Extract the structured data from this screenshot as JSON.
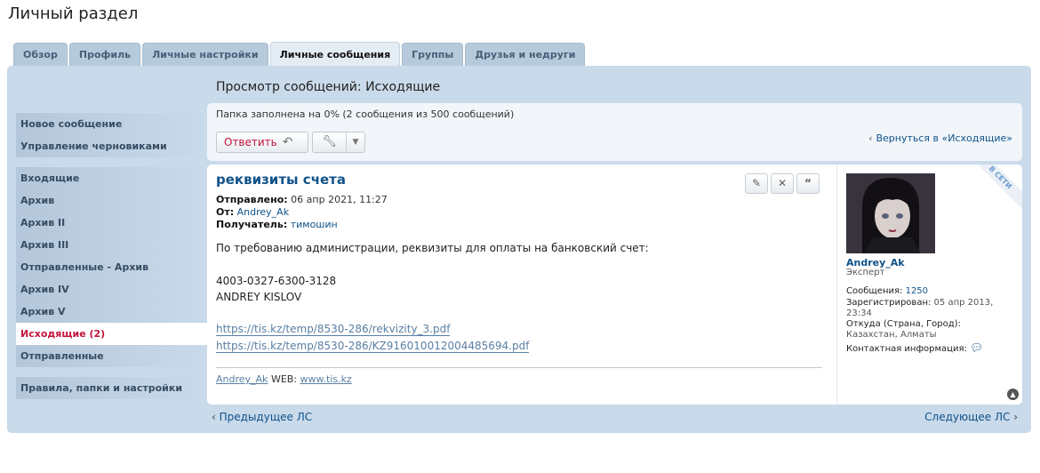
{
  "page": {
    "title": "Личный раздел"
  },
  "tabs": [
    {
      "label": "Обзор",
      "active": false
    },
    {
      "label": "Профиль",
      "active": false
    },
    {
      "label": "Личные настройки",
      "active": false
    },
    {
      "label": "Личные сообщения",
      "active": true
    },
    {
      "label": "Группы",
      "active": false
    },
    {
      "label": "Друзья и недруги",
      "active": false
    }
  ],
  "sidebar": {
    "group1": [
      "Новое сообщение",
      "Управление черновиками"
    ],
    "group2": [
      "Входящие",
      "Архив",
      "Архив II",
      "Архив III",
      "Отправленные - Архив",
      "Архив IV",
      "Архив V",
      "Исходящие (2)",
      "Отправленные"
    ],
    "group3": [
      "Правила, папки и настройки"
    ],
    "active_item": "Исходящие (2)"
  },
  "view": {
    "title": "Просмотр сообщений: Исходящие",
    "folder_status": "Папка заполнена на 0% (2 сообщения из 500 сообщений)",
    "reply_label": "Ответить",
    "back_link": "Вернуться в «Исходящие»"
  },
  "message": {
    "subject": "реквизиты счета",
    "sent_label": "Отправлено:",
    "sent_value": "06 апр 2021, 11:27",
    "from_label": "От:",
    "from_value": "Andrey_Ak",
    "to_label": "Получатель:",
    "to_value": "тимошин",
    "body_line1": "По требованию администрации, реквизиты для оплаты на банковский счет:",
    "account": "4003-0327-6300-3128",
    "holder": "ANDREY KISLOV",
    "attachments": [
      "https://tis.kz/temp/8530-286/rekvizity_3.pdf",
      "https://tis.kz/temp/8530-286/KZ916010012004485694.pdf"
    ],
    "signature": {
      "name": "Andrey_Ak",
      "web_label": "WEB:",
      "web_url": "www.tis.kz"
    }
  },
  "profile": {
    "username": "Andrey_Ak",
    "rank": "Эксперт",
    "online_label": "В СЕТИ",
    "posts_label": "Сообщения:",
    "posts_value": "1250",
    "registered_label": "Зарегистрирован:",
    "registered_value": "05 апр 2013, 23:34",
    "location_label": "Откуда (Страна, Город):",
    "location_value": "Казахстан, Алматы",
    "contact_label": "Контактная информация:"
  },
  "nav": {
    "prev": "Предыдущее ЛС",
    "next": "Следующее ЛС"
  },
  "colors": {
    "accent": "#105289",
    "active": "#c4143c",
    "panel": "#c9daea"
  }
}
